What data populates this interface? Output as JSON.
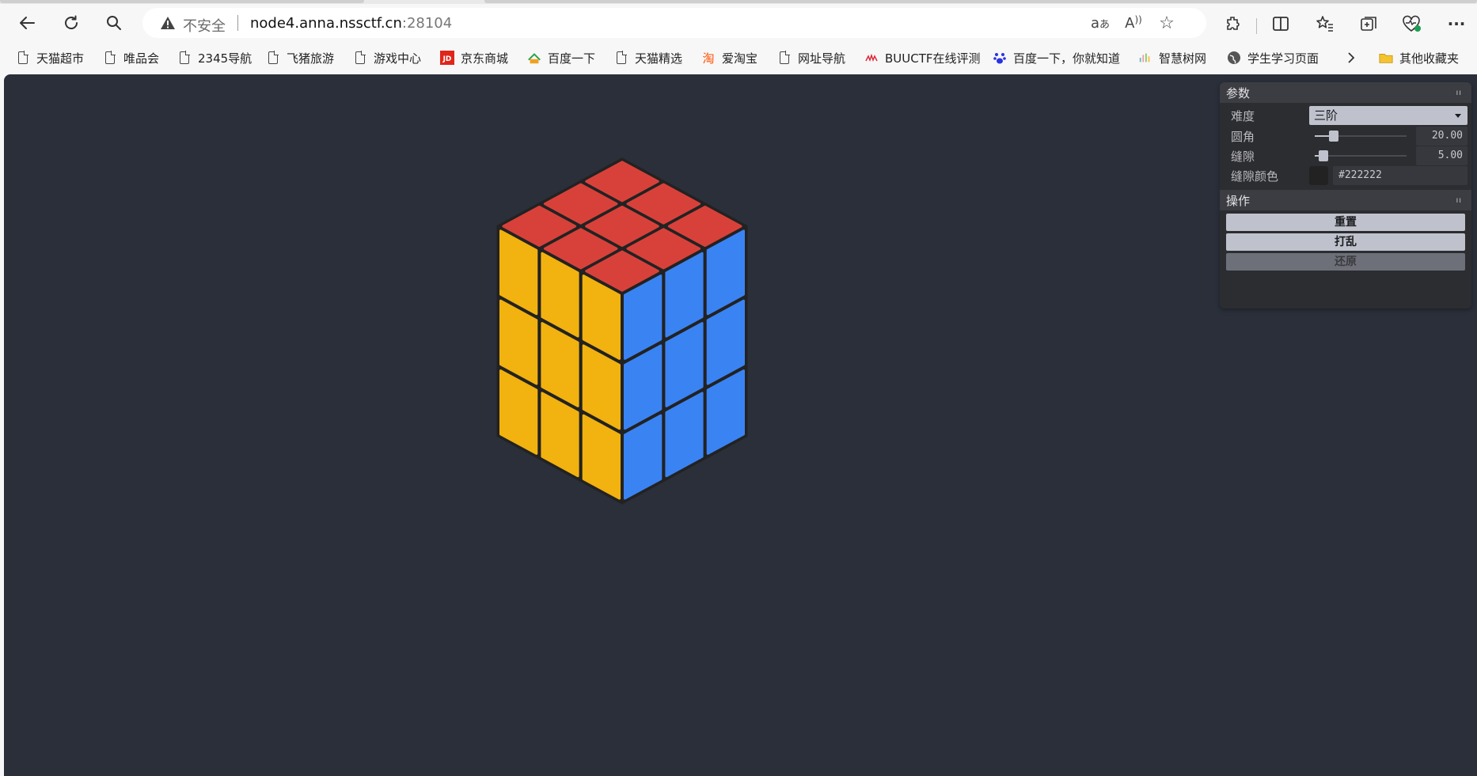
{
  "browser": {
    "address": {
      "security_label": "不安全",
      "url_host": "node4.anna.nssctf.cn",
      "url_port": ":28104"
    },
    "toolbar_icons": [
      "back-arrow-icon",
      "reload-icon",
      "search-icon",
      "translate-icon",
      "read-aloud-icon",
      "favorite-star-icon",
      "extensions-icon",
      "split-screen-icon",
      "favorites-icon",
      "collections-icon",
      "browser-essentials-icon",
      "more-icon"
    ],
    "bookmarks": [
      {
        "label": "天猫超市",
        "icon": "page-icon"
      },
      {
        "label": "唯品会",
        "icon": "page-icon"
      },
      {
        "label": "2345导航",
        "icon": "page-icon"
      },
      {
        "label": "飞猪旅游",
        "icon": "page-icon"
      },
      {
        "label": "游戏中心",
        "icon": "page-icon"
      },
      {
        "label": "京东商城",
        "icon": "jd-icon"
      },
      {
        "label": "百度一下",
        "icon": "2345-icon"
      },
      {
        "label": "天猫精选",
        "icon": "page-icon"
      },
      {
        "label": "爱淘宝",
        "icon": "taobao-icon"
      },
      {
        "label": "网址导航",
        "icon": "page-icon"
      },
      {
        "label": "BUUCTF在线评测",
        "icon": "buuctf-icon"
      },
      {
        "label": "百度一下，你就知道",
        "icon": "baidu-paw-icon"
      },
      {
        "label": "智慧树网",
        "icon": "zhihuishu-icon"
      },
      {
        "label": "学生学习页面",
        "icon": "globe-icon"
      }
    ],
    "other_bookmarks": "其他收藏夹"
  },
  "gui": {
    "params": {
      "title": "参数",
      "difficulty_label": "难度",
      "difficulty_value": "三阶",
      "radius_label": "圆角",
      "radius_value": "20.00",
      "radius_fraction": 0.17,
      "gap_label": "缝隙",
      "gap_value": "5.00",
      "gap_fraction": 0.05,
      "gap_color_label": "缝隙颜色",
      "gap_color_value": "#222222"
    },
    "actions": {
      "title": "操作",
      "reset": "重置",
      "scramble": "打乱",
      "restore": "还原"
    }
  },
  "colors": {
    "background": "#2a2f3a",
    "top_face": "#d8413a",
    "left_face": "#f2b20f",
    "right_face": "#3a83f3",
    "gap": "#222222"
  }
}
